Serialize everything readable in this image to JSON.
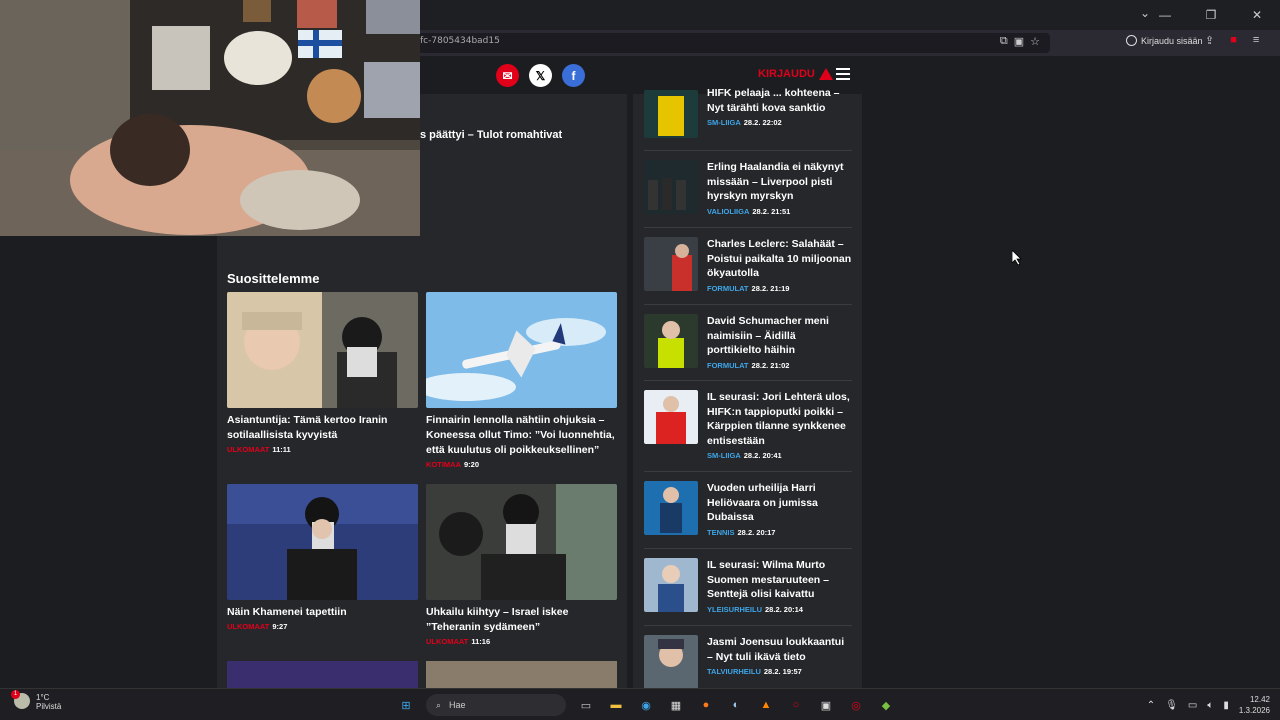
{
  "browser": {
    "url": "fc-7805434bad15",
    "signin_label": "Kirjaudu sisään"
  },
  "site": {
    "login_label": "KIRJAUDU",
    "partial_headline": "s päättyi – Tulot romahtivat"
  },
  "recommend": {
    "title": "Suosittelemme",
    "cards": [
      {
        "title": "Asiantuntija: Tämä kertoo Iranin sotilaal­lisista kyvyistä",
        "category": "ULKOMAAT",
        "time": "11:11"
      },
      {
        "title": "Finnairin lennolla nähtiin ohjuksia – Koneessa ollut Timo: ”Voi luonnehtia, että kuulutus oli poikkeuksellinen”",
        "category": "KOTIMAA",
        "time": "9:20"
      },
      {
        "title": "Näin Khamenei tapettiin",
        "category": "ULKOMAAT",
        "time": "9:27"
      },
      {
        "title": "Uhkailu kiihtyy – Israel iskee ”Teheranin sydämeen”",
        "category": "ULKOMAAT",
        "time": "11:16"
      }
    ]
  },
  "sidebar": {
    "items": [
      {
        "title": "HIFK pelaaja ... kohteena – Nyt tärähti kova sanktio",
        "category": "SM-LIIGA",
        "time": "28.2. 22:02"
      },
      {
        "title": "Erling Haalandia ei näkynyt missään – Liverpool pisti hyrskyn myrskyn",
        "category": "VALIOLIIGA",
        "time": "28.2. 21:51"
      },
      {
        "title": "Charles Leclerc: Salahäät – Poistui paikalta 10 miljoonan ökyautolla",
        "category": "FORMULAT",
        "time": "28.2. 21:19"
      },
      {
        "title": "David Schumacher meni naimisiin – Äidillä porttikielto häihin",
        "category": "FORMULAT",
        "time": "28.2. 21:02"
      },
      {
        "title": "IL seurasi: Jori Lehterä ulos, HIFK:n tappioputki poikki – Kärppien tilanne synkkenee entisestään",
        "category": "SM-LIIGA",
        "time": "28.2. 20:41"
      },
      {
        "title": "Vuoden urheilija Harri Heliövaara on jumissa Dubaissa",
        "category": "TENNIS",
        "time": "28.2. 20:17"
      },
      {
        "title": "IL seurasi: Wilma Murto Suomen mestaruuteen – Senttejä olisi kaivattu",
        "category": "YLEISURHEILU",
        "time": "28.2. 20:14"
      },
      {
        "title": "Jasmi Joensuu loukkaantui – Nyt tuli ikävä tieto",
        "category": "TALVIURHEILU",
        "time": "28.2. 19:57"
      }
    ]
  },
  "taskbar": {
    "weather_temp": "1°C",
    "weather_desc": "Pilvistä",
    "weather_badge": "1",
    "search_placeholder": "Hae",
    "time": "12.42",
    "date": "1.3.2026"
  },
  "colors": {
    "brand_red": "#e1001a",
    "sport_blue": "#3ea6e8"
  }
}
